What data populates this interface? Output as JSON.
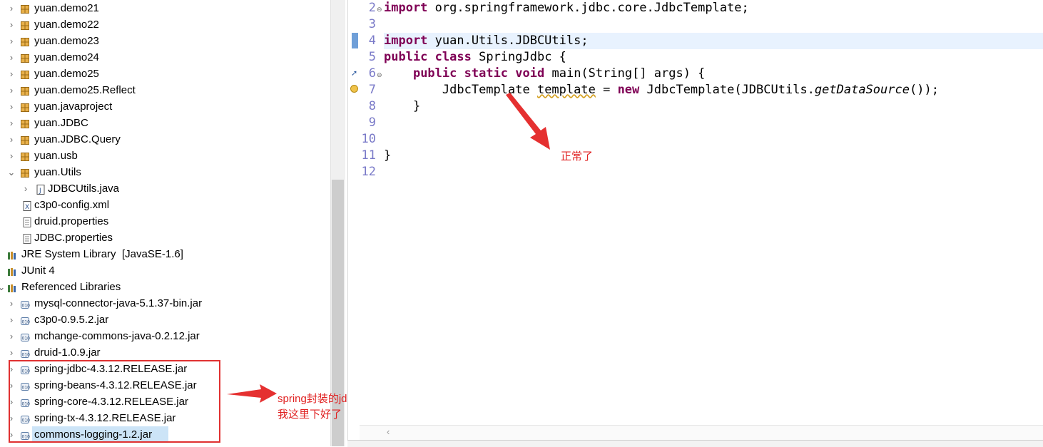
{
  "explorer": {
    "items": [
      {
        "label": "yuan.demo21",
        "icon": "package-icon",
        "chev": "›"
      },
      {
        "label": "yuan.demo22",
        "icon": "package-icon",
        "chev": "›"
      },
      {
        "label": "yuan.demo23",
        "icon": "package-icon",
        "chev": "›"
      },
      {
        "label": "yuan.demo24",
        "icon": "package-icon",
        "chev": "›"
      },
      {
        "label": "yuan.demo25",
        "icon": "package-icon",
        "chev": "›"
      },
      {
        "label": "yuan.demo25.Reflect",
        "icon": "package-icon",
        "chev": "›"
      },
      {
        "label": "yuan.javaproject",
        "icon": "package-icon",
        "chev": "›"
      },
      {
        "label": "yuan.JDBC",
        "icon": "package-icon",
        "chev": "›"
      },
      {
        "label": "yuan.JDBC.Query",
        "icon": "package-icon",
        "chev": "›"
      },
      {
        "label": "yuan.usb",
        "icon": "package-icon",
        "chev": "›"
      },
      {
        "label": "yuan.Utils",
        "icon": "package-icon",
        "chev": "⌄"
      },
      {
        "label": "JDBCUtils.java",
        "icon": "java-file-icon",
        "chev": "›"
      },
      {
        "label": "c3p0-config.xml",
        "icon": "xml-file-icon",
        "chev": ""
      },
      {
        "label": "druid.properties",
        "icon": "properties-file-icon",
        "chev": ""
      },
      {
        "label": "JDBC.properties",
        "icon": "properties-file-icon",
        "chev": ""
      },
      {
        "label": "JRE System Library",
        "suffix": "[JavaSE-1.6]",
        "icon": "library-icon",
        "chev": ""
      },
      {
        "label": "JUnit 4",
        "icon": "library-icon",
        "chev": ""
      },
      {
        "label": "Referenced Libraries",
        "icon": "library-icon",
        "chev": "⌄"
      },
      {
        "label": "mysql-connector-java-5.1.37-bin.jar",
        "icon": "jar-icon",
        "chev": "›"
      },
      {
        "label": "c3p0-0.9.5.2.jar",
        "icon": "jar-icon",
        "chev": "›"
      },
      {
        "label": "mchange-commons-java-0.2.12.jar",
        "icon": "jar-icon",
        "chev": "›"
      },
      {
        "label": "druid-1.0.9.jar",
        "icon": "jar-icon",
        "chev": "›"
      },
      {
        "label": "spring-jdbc-4.3.12.RELEASE.jar",
        "icon": "jar-icon",
        "chev": "›"
      },
      {
        "label": "spring-beans-4.3.12.RELEASE.jar",
        "icon": "jar-icon",
        "chev": "›"
      },
      {
        "label": "spring-core-4.3.12.RELEASE.jar",
        "icon": "jar-icon",
        "chev": "›"
      },
      {
        "label": "spring-tx-4.3.12.RELEASE.jar",
        "icon": "jar-icon",
        "chev": "›"
      },
      {
        "label": "commons-logging-1.2.jar",
        "icon": "jar-icon",
        "chev": "›"
      }
    ]
  },
  "editor": {
    "line_numbers": [
      "2",
      "3",
      "4",
      "5",
      "6",
      "7",
      "8",
      "9",
      "10",
      "11",
      "12"
    ],
    "lines": {
      "l2": {
        "kw": "import",
        "rest": " org.springframework.jdbc.core.JdbcTemplate;"
      },
      "l4": {
        "kw": "import",
        "rest": " yuan.Utils.JDBCUtils;"
      },
      "l5": {
        "kw1": "public",
        "kw2": "class",
        "rest": " SpringJdbc {"
      },
      "l6": {
        "indent": "    ",
        "kw1": "public",
        "kw2": "static",
        "kw3": "void",
        "rest": " main(String[] args) {"
      },
      "l7": {
        "indent": "        ",
        "a": "JdbcTemplate ",
        "var": "template",
        "b": " = ",
        "kw": "new",
        "c": " JdbcTemplate(JDBCUtils.",
        "method": "getDataSource",
        "d": "());"
      },
      "l8": {
        "text": "    }"
      },
      "l11": {
        "text": "}"
      }
    }
  },
  "annotations": {
    "normal": "正常了",
    "jar_note_line1": "spring封装的jdbc操作的jar包",
    "jar_note_line2": "我这里下好了"
  },
  "colors": {
    "keyword": "#7f0055",
    "line_number": "#7a7ac8",
    "annotation_red": "#e02020",
    "selection": "#cce4f7"
  }
}
